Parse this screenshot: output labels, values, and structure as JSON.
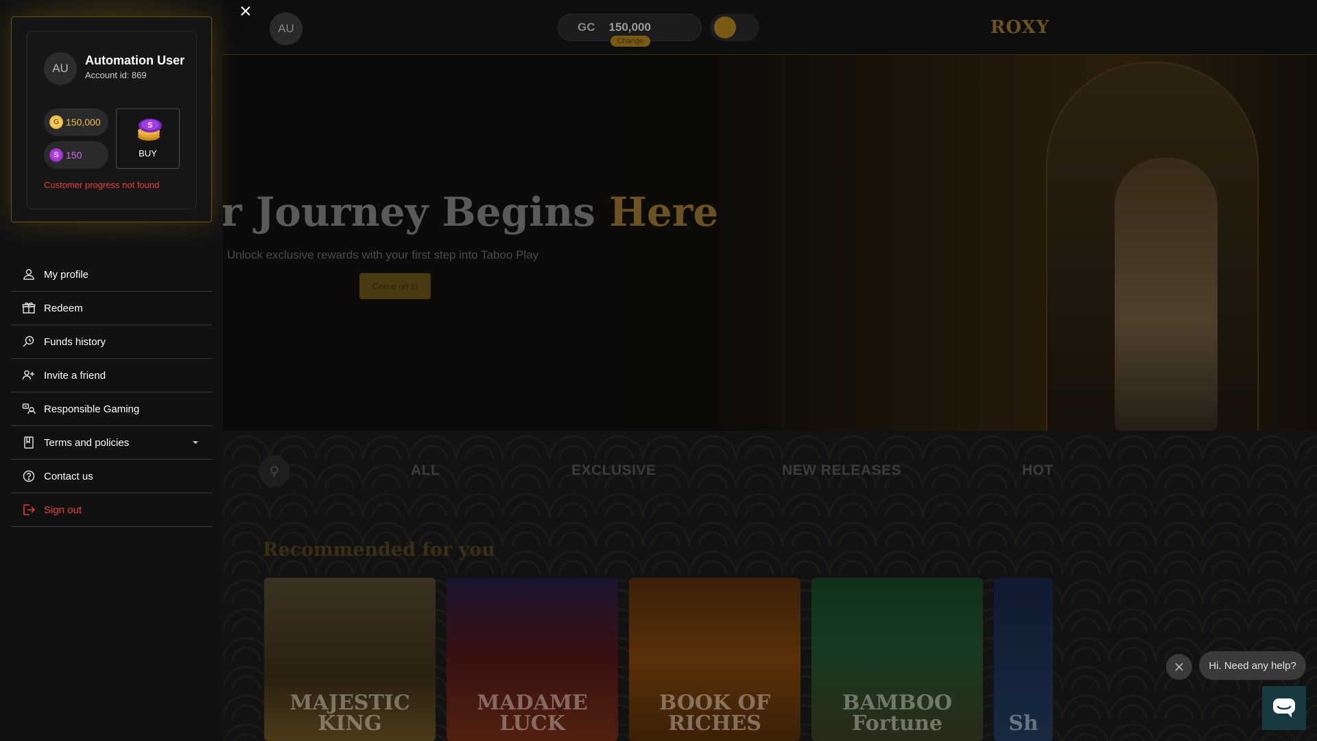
{
  "topbar": {
    "avatar_initials": "AU",
    "balance_currency": "GC",
    "balance_value": "150,000",
    "change_label": "Change",
    "logo_text": "ROXY"
  },
  "hero": {
    "title_part1": "r Journey Begins ",
    "title_accent": "Here",
    "subtitle": "Unlock exclusive rewards with your first step into Taboo Play",
    "cta_label": "Come on in"
  },
  "lobby": {
    "tabs": [
      "ALL",
      "EXCLUSIVE",
      "NEW RELEASES",
      "HOT"
    ],
    "section_heading": "Recommended for you",
    "games": [
      "MAJESTIC KING",
      "MADAME LUCK",
      "BOOK OF RICHES",
      "BAMBOO Fortune",
      "Sh"
    ]
  },
  "account": {
    "initials": "AU",
    "name": "Automation User",
    "account_id": "Account id: 869",
    "gold_coins": "150,000",
    "sweep_coins": "150",
    "buy_label": "BUY",
    "progress_message": "Customer progress not found"
  },
  "menu": {
    "items": [
      {
        "label": "My profile",
        "icon": "user-icon"
      },
      {
        "label": "Redeem",
        "icon": "gift-icon"
      },
      {
        "label": "Funds history",
        "icon": "history-search-icon"
      },
      {
        "label": "Invite a friend",
        "icon": "user-plus-icon"
      },
      {
        "label": "Responsible Gaming",
        "icon": "responsible-gaming-icon"
      },
      {
        "label": "Terms and policies",
        "icon": "document-icon"
      },
      {
        "label": "Contact us",
        "icon": "help-circle-icon"
      },
      {
        "label": "Sign out",
        "icon": "sign-out-icon"
      }
    ]
  },
  "chat": {
    "bubble_text": "Hi. Need any help?"
  },
  "colors": {
    "accent_gold": "#c99520",
    "danger_red": "#e8403a",
    "drawer_bg": "#111111",
    "chat_launcher": "#163a40"
  }
}
